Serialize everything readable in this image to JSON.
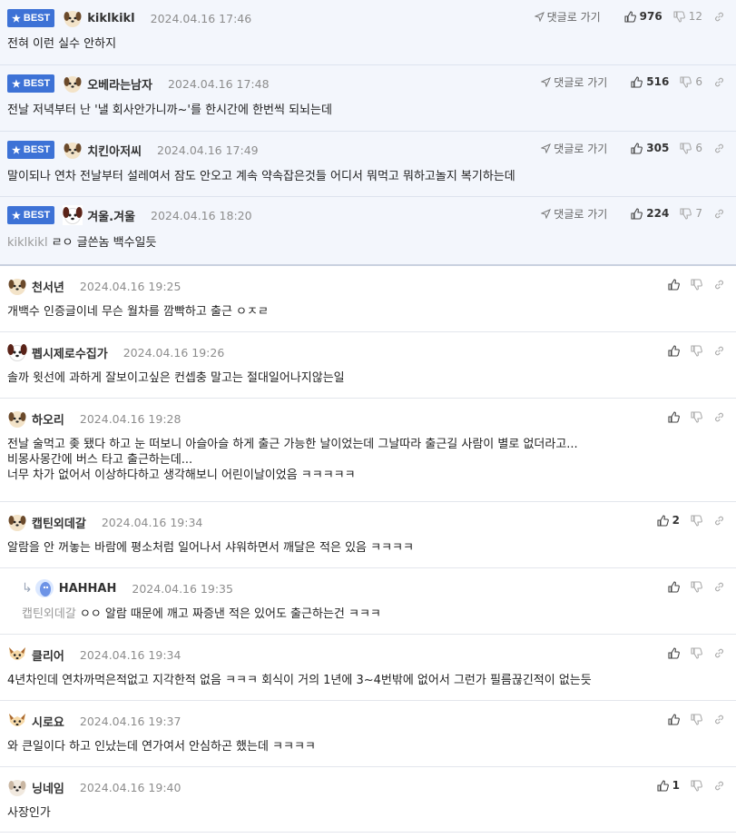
{
  "best_badge_label": "BEST",
  "reply_link_label": "댓글로 가기",
  "comments": [
    {
      "nick": "kiklkikl",
      "date": "2024.04.16 17:46",
      "body": "전혀 이런 실수 안하지",
      "up": "976",
      "down": "12"
    },
    {
      "nick": "오베라는남자",
      "date": "2024.04.16 17:48",
      "body": "전날 저녁부터 난 '낼 회사안가니까~'를 한시간에 한번씩 되뇌는데",
      "up": "516",
      "down": "6"
    },
    {
      "nick": "치킨아저씨",
      "date": "2024.04.16 17:49",
      "body": "말이되나 연차 전날부터 설레여서 잠도 안오고 계속 약속잡은것들 어디서 뭐먹고 뭐하고놀지 복기하는데",
      "up": "305",
      "down": "6"
    },
    {
      "nick": "겨울.겨울",
      "date": "2024.04.16 18:20",
      "mention": "kiklkikl",
      "body": "ㄹㅇ 글쓴놈 백수일듯",
      "up": "224",
      "down": "7"
    },
    {
      "nick": "천서년",
      "date": "2024.04.16 19:25",
      "body": "개백수 인증글이네 무슨 월차를 깜빡하고 출근 ㅇㅈㄹ"
    },
    {
      "nick": "펩시제로수집가",
      "date": "2024.04.16 19:26",
      "body": "솔까 윗선에 과하게 잘보이고싶은 컨셉충 말고는 절대일어나지않는일"
    },
    {
      "nick": "하오리",
      "date": "2024.04.16 19:28",
      "body": "전날 술먹고 좆 됐다 하고 눈 떠보니 아슬아슬 하게 출근 가능한 날이었는데 그날따라 출근길 사람이 별로 없더라고...\n비몽사몽간에 버스 타고 출근하는데...\n너무 차가 없어서 이상하다하고 생각해보니 어린이날이었음 ㅋㅋㅋㅋㅋ"
    },
    {
      "nick": "캡틴외데갈",
      "date": "2024.04.16 19:34",
      "body": "알람을 안 꺼놓는 바람에 평소처럼 일어나서 샤워하면서 깨달은 적은 있음 ㅋㅋㅋㅋ",
      "up": "2"
    },
    {
      "nick": "HAHHAH",
      "date": "2024.04.16 19:35",
      "mention": "캡틴외데갈",
      "body": "ㅇㅇ 알람 때문에 깨고 짜증낸 적은 있어도 출근하는건 ㅋㅋㅋ"
    },
    {
      "nick": "클리어",
      "date": "2024.04.16 19:34",
      "body": "4년차인데 연차까먹은적없고 지각한적 없음 ㅋㅋㅋ 회식이 거의 1년에 3~4번밖에 없어서 그런가 필름끊긴적이 없는듯"
    },
    {
      "nick": "시로요",
      "date": "2024.04.16 19:37",
      "body": "와 큰일이다 하고 인났는데 연가여서 안심하곤 했는데 ㅋㅋㅋㅋ"
    },
    {
      "nick": "닝네임",
      "date": "2024.04.16 19:40",
      "body": "사장인가",
      "up": "1"
    }
  ],
  "colors": {
    "best_bg": "#f3f6fc",
    "badge": "#3d72d6",
    "date": "#8d8d8d",
    "mention": "#999999"
  }
}
